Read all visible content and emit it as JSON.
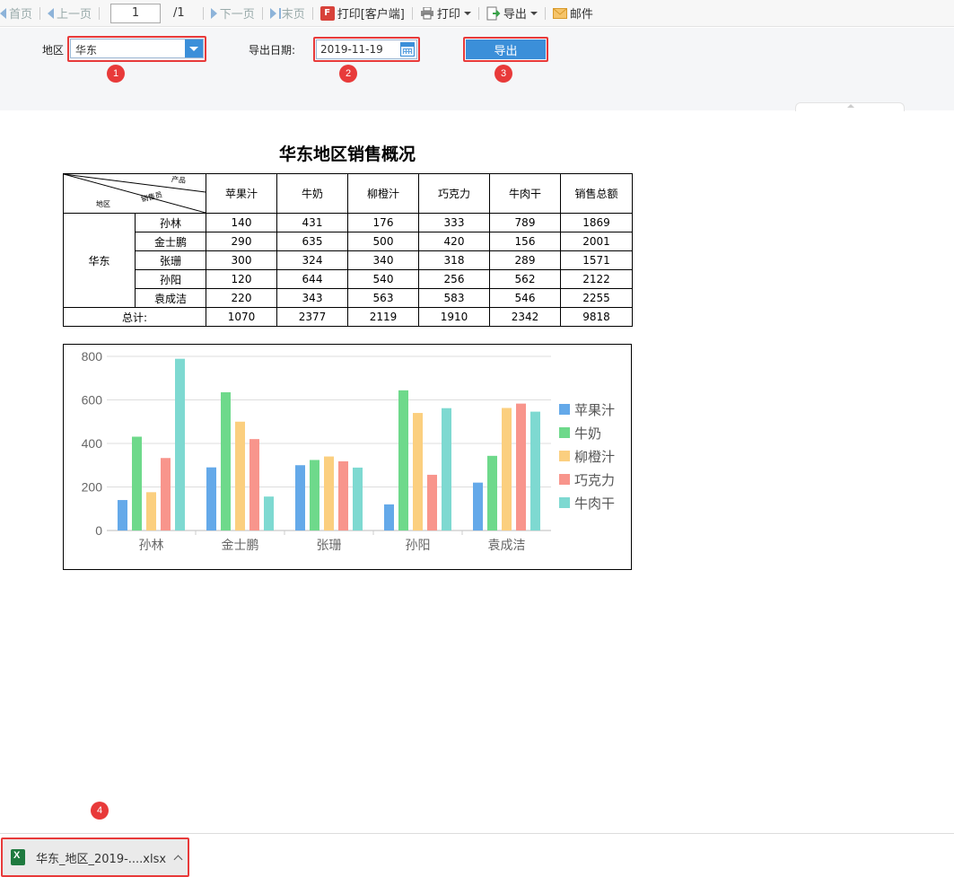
{
  "toolbar": {
    "first": "首页",
    "prev": "上一页",
    "page_value": "1",
    "page_total": "/1",
    "next": "下一页",
    "last": "末页",
    "print_client": "打印[客户端]",
    "print": "打印",
    "export": "导出",
    "mail": "邮件"
  },
  "params": {
    "region_label": "地区",
    "region_value": "华东",
    "date_label": "导出日期:",
    "date_value": "2019-11-19",
    "export_button": "导出"
  },
  "badges": [
    "1",
    "2",
    "3",
    "4"
  ],
  "report": {
    "title": "华东地区销售概况",
    "corner": {
      "product": "产品",
      "salesperson": "销售员",
      "region": "地区"
    },
    "columns": [
      "苹果汁",
      "牛奶",
      "柳橙汁",
      "巧克力",
      "牛肉干",
      "销售总额"
    ],
    "region": "华东",
    "rows": [
      {
        "name": "孙林",
        "values": [
          "140",
          "431",
          "176",
          "333",
          "789",
          "1869"
        ]
      },
      {
        "name": "金士鹏",
        "values": [
          "290",
          "635",
          "500",
          "420",
          "156",
          "2001"
        ]
      },
      {
        "name": "张珊",
        "values": [
          "300",
          "324",
          "340",
          "318",
          "289",
          "1571"
        ]
      },
      {
        "name": "孙阳",
        "values": [
          "120",
          "644",
          "540",
          "256",
          "562",
          "2122"
        ]
      },
      {
        "name": "袁成洁",
        "values": [
          "220",
          "343",
          "563",
          "583",
          "546",
          "2255"
        ]
      }
    ],
    "total_label": "总计:",
    "totals": [
      "1070",
      "2377",
      "2119",
      "1910",
      "2342",
      "9818"
    ]
  },
  "chart_data": {
    "type": "bar",
    "categories": [
      "孙林",
      "金士鹏",
      "张珊",
      "孙阳",
      "袁成洁"
    ],
    "series": [
      {
        "name": "苹果汁",
        "values": [
          140,
          290,
          300,
          120,
          220
        ],
        "color": "#64a9e9"
      },
      {
        "name": "牛奶",
        "values": [
          431,
          635,
          324,
          644,
          343
        ],
        "color": "#6ed98b"
      },
      {
        "name": "柳橙汁",
        "values": [
          176,
          500,
          340,
          540,
          563
        ],
        "color": "#fbcf7f"
      },
      {
        "name": "巧克力",
        "values": [
          333,
          420,
          318,
          256,
          583
        ],
        "color": "#f8958c"
      },
      {
        "name": "牛肉干",
        "values": [
          789,
          156,
          289,
          562,
          546
        ],
        "color": "#7ed9d1"
      }
    ],
    "yticks": [
      "0",
      "200",
      "400",
      "600",
      "800"
    ],
    "ylim": [
      0,
      800
    ],
    "grid": true,
    "legend": "right"
  },
  "download": {
    "filename": "华东_地区_2019-....xlsx"
  }
}
